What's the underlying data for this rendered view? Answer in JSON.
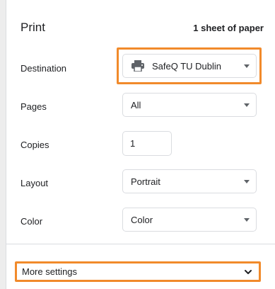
{
  "header": {
    "title": "Print",
    "summary": "1 sheet of paper"
  },
  "destination": {
    "label": "Destination",
    "value": "SafeQ TU Dublin",
    "icon": "printer-icon"
  },
  "pages": {
    "label": "Pages",
    "value": "All"
  },
  "copies": {
    "label": "Copies",
    "value": "1"
  },
  "layout": {
    "label": "Layout",
    "value": "Portrait"
  },
  "color": {
    "label": "Color",
    "value": "Color"
  },
  "more_settings": {
    "label": "More settings",
    "icon": "chevron-down-icon"
  },
  "colors": {
    "highlight": "#f18a2b",
    "border": "#dadce0",
    "text": "#202124",
    "background": "#ededed"
  }
}
